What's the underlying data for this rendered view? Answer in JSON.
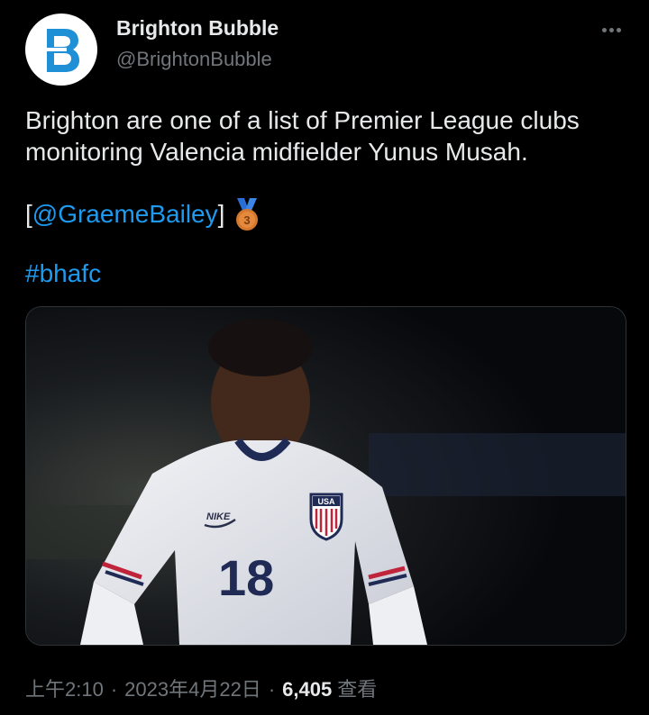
{
  "account": {
    "name": "Brighton Bubble",
    "handle": "@BrightonBubble",
    "avatar_letter": "B"
  },
  "tweet": {
    "text_line1": "Brighton are one of a list of Premier League clubs",
    "text_line2": "monitoring Valencia midfielder Yunus Musah.",
    "bracket_open": "[",
    "mention": "@GraemeBailey",
    "bracket_close": "]",
    "medal_number": "3",
    "hashtag": "#bhafc"
  },
  "image": {
    "jersey_brand": "NIKE",
    "jersey_crest": "USA",
    "jersey_number": "18"
  },
  "meta": {
    "time": "上午2:10",
    "separator": "·",
    "date": "2023年4月22日",
    "views": "6,405",
    "views_label": "查看"
  },
  "colors": {
    "background": "#000000",
    "text": "#e7e9ea",
    "secondary": "#71767b",
    "link": "#1d9bf0",
    "brand": "#1f8fd6"
  }
}
